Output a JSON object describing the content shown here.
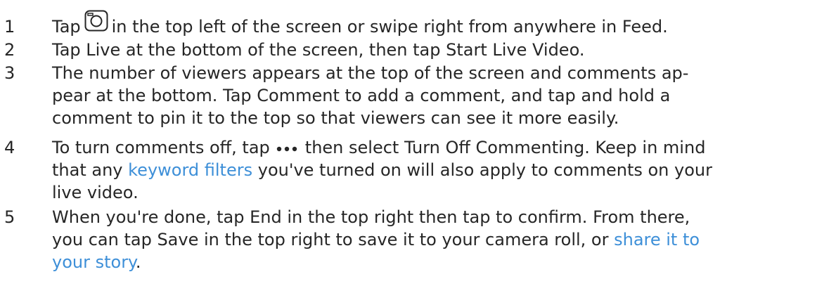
{
  "steps": [
    {
      "number": "1",
      "lines": [
        {
          "before": "Tap",
          "icon": "camera-icon",
          "after": "in the top left of the screen or swipe right from anywhere in Feed."
        }
      ]
    },
    {
      "number": "2",
      "lines": [
        {
          "text": "Tap Live at the bottom of the screen, then tap Start Live Video."
        }
      ]
    },
    {
      "number": "3",
      "lines": [
        {
          "text": "The number of viewers appears at the top of the screen and comments ap-"
        },
        {
          "text": "pear at the bottom. Tap Comment to add a comment, and tap and hold a"
        },
        {
          "text": "comment to pin it to the top so that viewers can see it more easily."
        }
      ]
    },
    {
      "number": "4",
      "lines": [
        {
          "before": "To turn comments off, tap",
          "icon": "more-icon",
          "after": "then select Turn Off Commenting. Keep in mind"
        },
        {
          "text": "that any",
          "link": "keyword filters",
          "after": "you've turned on will also apply to comments on your"
        },
        {
          "text": "live video."
        }
      ]
    },
    {
      "number": "5",
      "lines": [
        {
          "text": "When you're done, tap End in the top right then tap to confirm. From there,"
        },
        {
          "text": "you can tap Save in the top right to save it to your camera roll, or",
          "link": "share it to"
        },
        {
          "link": "your story",
          "after": "."
        }
      ]
    }
  ],
  "colors": {
    "text": "#262626",
    "link": "#3d8fd8",
    "icon": "#262626"
  }
}
